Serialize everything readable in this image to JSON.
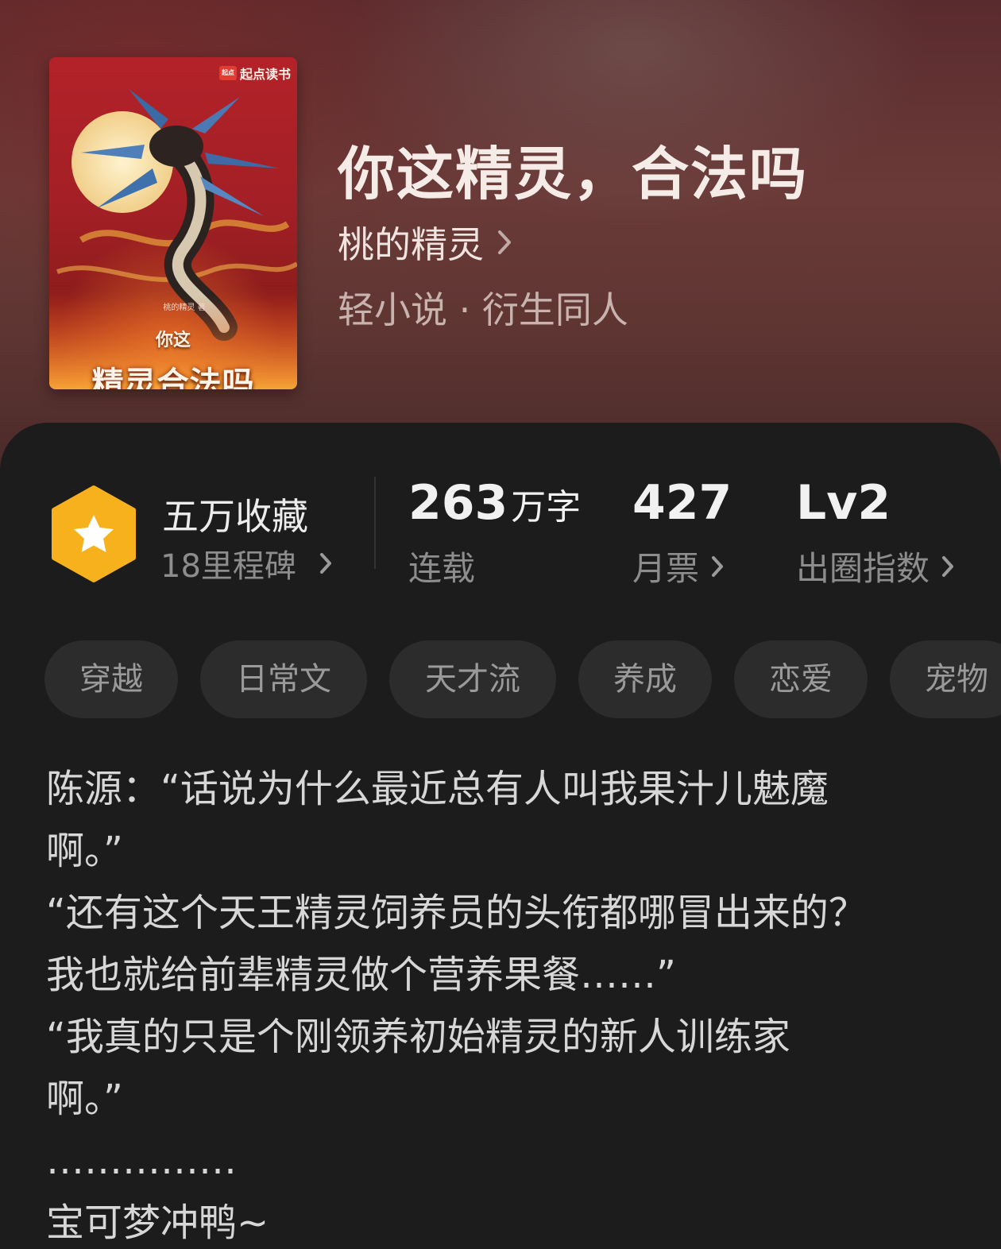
{
  "book": {
    "title": "你这精灵，合法吗",
    "author": "桃的精灵",
    "category": "轻小说 · 衍生同人",
    "cover": {
      "brand": "起点读书",
      "brand_badge": "起点",
      "author_small": "桃的精灵 著",
      "subtitle": "你这",
      "title_art": "精灵合法吗"
    }
  },
  "stats": {
    "favorites": {
      "title": "五万收藏",
      "subtitle": "18里程碑",
      "icon": "star-icon"
    },
    "words": {
      "value": "263",
      "unit": "万字",
      "label": "连载"
    },
    "monthly_tickets": {
      "value": "427",
      "label": "月票"
    },
    "breakout_index": {
      "value": "Lv2",
      "label": "出圈指数"
    }
  },
  "tags": [
    "穿越",
    "日常文",
    "天才流",
    "养成",
    "恋爱",
    "宠物"
  ],
  "description": [
    "陈源：“话说为什么最近总有人叫我果汁儿魅魔",
    "啊。”",
    "“还有这个天王精灵饲养员的头衔都哪冒出来的？",
    "我也就给前辈精灵做个营养果餐……”",
    "“我真的只是个刚领养初始精灵的新人训练家",
    "啊。”",
    "……………",
    "宝可梦冲鸭~"
  ],
  "colors": {
    "hero_bg": "#5e3532",
    "panel_bg": "#1c1c1c",
    "tag_bg": "#2c2c2c",
    "badge_gold": "#f6b11c"
  }
}
